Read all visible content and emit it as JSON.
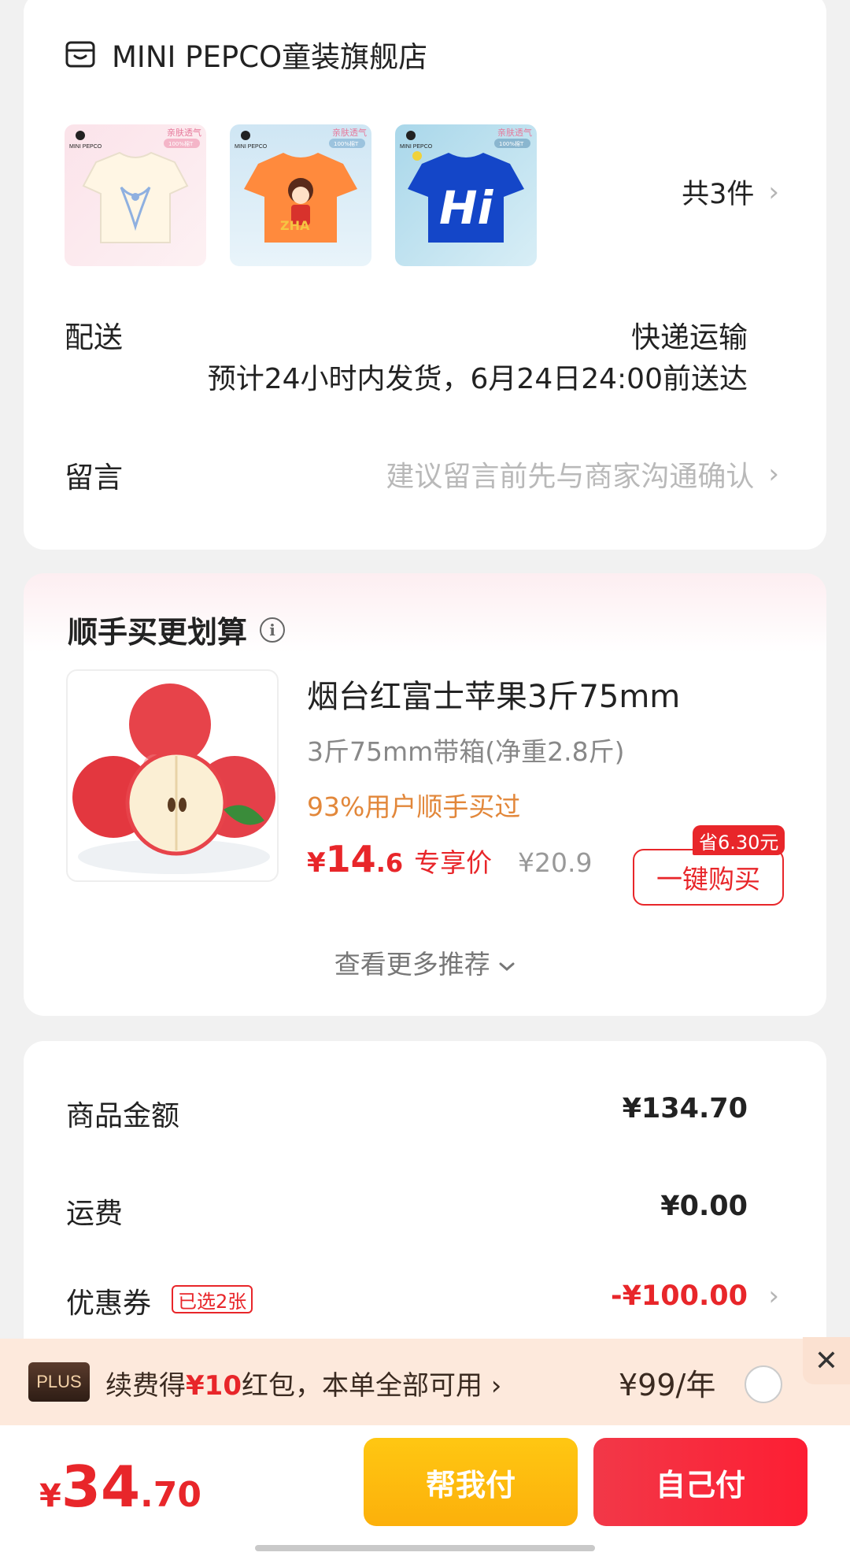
{
  "store": {
    "name": "MINI PEPCO童装旗舰店",
    "item_count": "共3件",
    "thumbs": [
      {
        "icon": "cream-tshirt-bow",
        "brand": "MINI PEPCO",
        "tag1": "亲肤透气",
        "tag2": "100%棉T"
      },
      {
        "icon": "orange-tshirt-girl",
        "brand": "MINI PEPCO",
        "tag1": "亲肤透气",
        "tag2": "100%棉T"
      },
      {
        "icon": "blue-tshirt-hi",
        "brand": "MINI PEPCO",
        "tag1": "亲肤透气",
        "tag2": "100%棉T"
      }
    ]
  },
  "shipping": {
    "label": "配送",
    "method": "快递运输",
    "eta": "预计24小时内发货，6月24日24:00前送达"
  },
  "message": {
    "label": "留言",
    "placeholder": "建议留言前先与商家沟通确认"
  },
  "recommend": {
    "title": "顺手买更划算",
    "product_name": "烟台红富士苹果3斤75mm",
    "spec": "3斤75mm带箱(净重2.8斤)",
    "social_proof": "93%用户顺手买过",
    "price_currency": "¥",
    "price_int": "14",
    "price_dec": ".6",
    "price_tag": "专享价",
    "original_price": "¥20.9",
    "save_badge": "省6.30元",
    "buy_button": "一键购买",
    "more": "查看更多推荐"
  },
  "summary": {
    "goods_label": "商品金额",
    "goods_value": "¥134.70",
    "shipping_label": "运费",
    "shipping_value": "¥0.00",
    "coupon_label": "优惠券",
    "coupon_tag": "已选2张",
    "coupon_value": "-¥100.00"
  },
  "plus": {
    "badge": "PLUS",
    "text_before": "续费得",
    "text_highlight": "¥10",
    "text_after": "红包，本单全部可用",
    "price": "¥99/年"
  },
  "bottom": {
    "total_currency": "¥",
    "total_int": "34",
    "total_dec": ".70",
    "help_pay": "帮我付",
    "self_pay": "自己付"
  },
  "colors": {
    "accent_red": "#e8262a",
    "help_yellow": "#fcb00b",
    "social_orange": "#e2873a"
  }
}
